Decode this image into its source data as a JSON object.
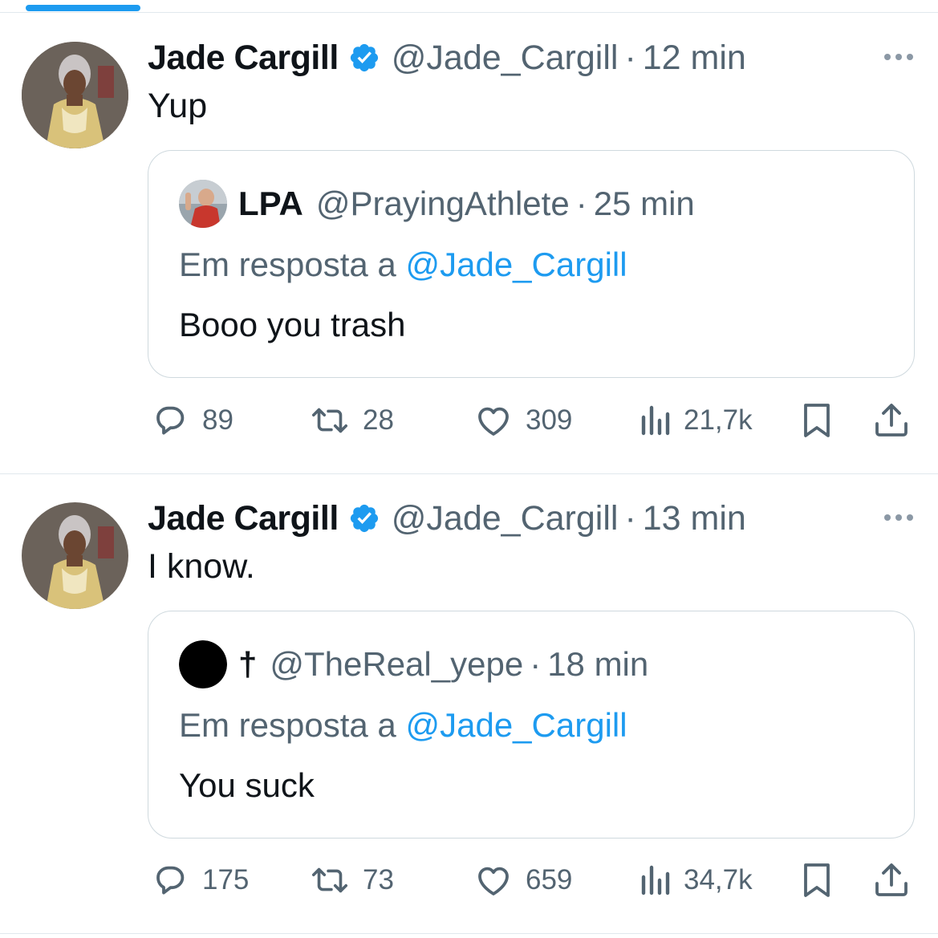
{
  "colors": {
    "accent": "#1d9bf0",
    "secondary_text": "#536471",
    "primary_text": "#0f1419",
    "border": "#cfd9de"
  },
  "tweets": [
    {
      "author": {
        "name": "Jade Cargill",
        "handle": "@Jade_Cargill",
        "verified": true
      },
      "separator": "·",
      "time": "12 min",
      "text": "Yup",
      "quote": {
        "name": "LPA",
        "handle": "@PrayingAthlete",
        "separator": "·",
        "time": "25 min",
        "reply_prefix": "Em resposta a",
        "reply_mention": "@Jade_Cargill",
        "text": "Booo you trash"
      },
      "actions": {
        "replies": "89",
        "reposts": "28",
        "likes": "309",
        "views": "21,7k"
      }
    },
    {
      "author": {
        "name": "Jade Cargill",
        "handle": "@Jade_Cargill",
        "verified": true
      },
      "separator": "·",
      "time": "13 min",
      "text": "I know.",
      "quote": {
        "name": "†",
        "handle": "@TheReal_yepe",
        "separator": "·",
        "time": "18 min",
        "reply_prefix": "Em resposta a",
        "reply_mention": "@Jade_Cargill",
        "text": "You suck"
      },
      "actions": {
        "replies": "175",
        "reposts": "73",
        "likes": "659",
        "views": "34,7k"
      }
    }
  ]
}
